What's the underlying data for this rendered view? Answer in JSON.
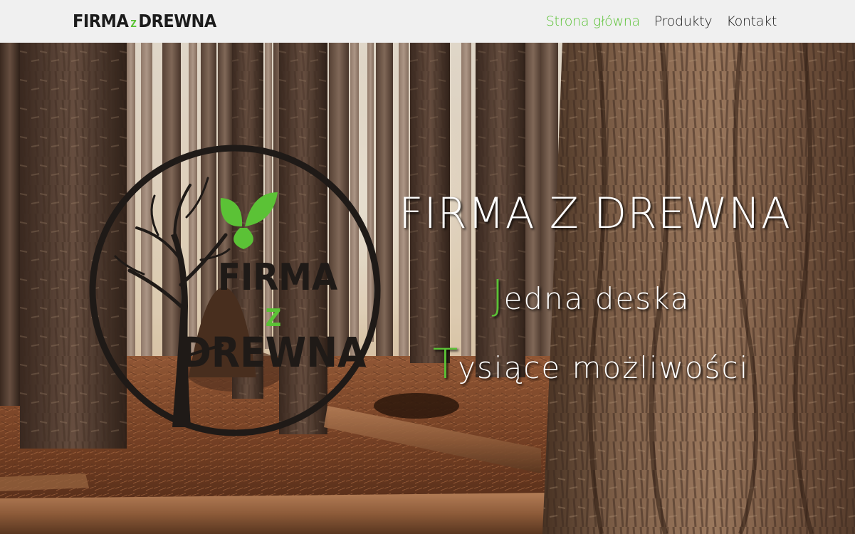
{
  "brand": {
    "part1": "FIRMA",
    "part2": "Z",
    "part3": "DREWNA",
    "accent_color": "#5bc236"
  },
  "nav": {
    "items": [
      {
        "label": "Strona główna",
        "active": true
      },
      {
        "label": "Produkty",
        "active": false
      },
      {
        "label": "Kontakt",
        "active": false
      }
    ],
    "active_color": "#5bc236",
    "text_color": "#1a1a1a"
  },
  "hero": {
    "title": "FIRMA Z DREWNA",
    "tagline1": {
      "first": "J",
      "rest": "edna deska"
    },
    "tagline2": {
      "first": "T",
      "rest": "ysiące możliwości"
    },
    "accent_color": "#5bc236",
    "logo": {
      "line1": "FIRMA",
      "line2": "Z",
      "line3": "DREWNA",
      "leaf_color": "#5bc236"
    }
  }
}
